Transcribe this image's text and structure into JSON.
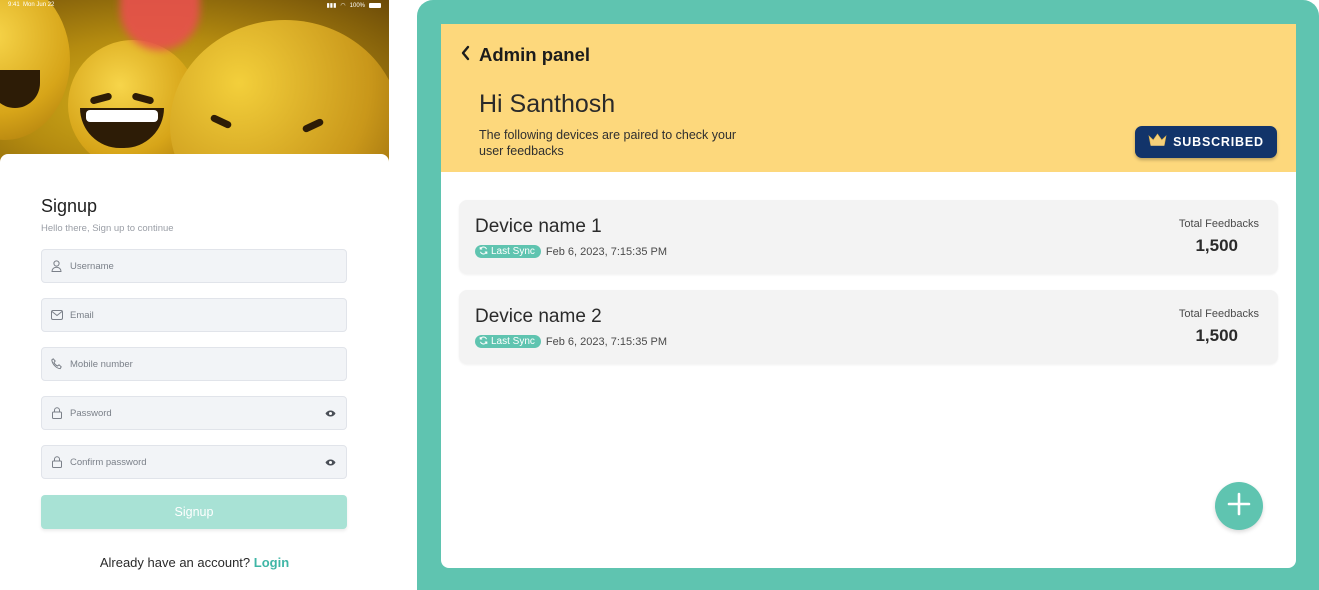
{
  "signup_screen": {
    "status_bar": {
      "time": "9:41",
      "date": "Mon Jun 22",
      "battery": "100%"
    },
    "title": "Signup",
    "subtitle": "Hello there, Sign up to continue",
    "fields": [
      {
        "placeholder": "Username",
        "icon": "user-icon"
      },
      {
        "placeholder": "Email",
        "icon": "mail-icon"
      },
      {
        "placeholder": "Mobile number",
        "icon": "phone-icon"
      },
      {
        "placeholder": "Password",
        "icon": "lock-icon"
      },
      {
        "placeholder": "Confirm password",
        "icon": "lock-icon"
      }
    ],
    "signup_button": "Signup",
    "login_prompt": "Already have an account?",
    "login_link": "Login"
  },
  "admin_panel": {
    "title": "Admin panel",
    "greeting": "Hi Santhosh",
    "info": "The following devices are paired to check your user feedbacks",
    "subscribed_label": "SUBSCRIBED",
    "devices": [
      {
        "name": "Device name 1",
        "sync_label": "Last Sync",
        "sync_date": "Feb 6, 2023, 7:15:35 PM",
        "feedback_label": "Total Feedbacks",
        "feedback_count": "1,500"
      },
      {
        "name": "Device name 2",
        "sync_label": "Last Sync",
        "sync_date": "Feb 6, 2023, 7:15:35 PM",
        "feedback_label": "Total Feedbacks",
        "feedback_count": "1,500"
      }
    ]
  },
  "colors": {
    "accent_teal": "#5fc4b0",
    "header_yellow": "#fdd87c",
    "badge_navy": "#12346a",
    "signup_button_disabled": "#a8e2d5"
  },
  "icons": [
    "back-chevron-icon",
    "crown-icon",
    "sync-icon",
    "plus-icon",
    "user-icon",
    "mail-icon",
    "phone-icon",
    "lock-icon",
    "eye-icon"
  ]
}
